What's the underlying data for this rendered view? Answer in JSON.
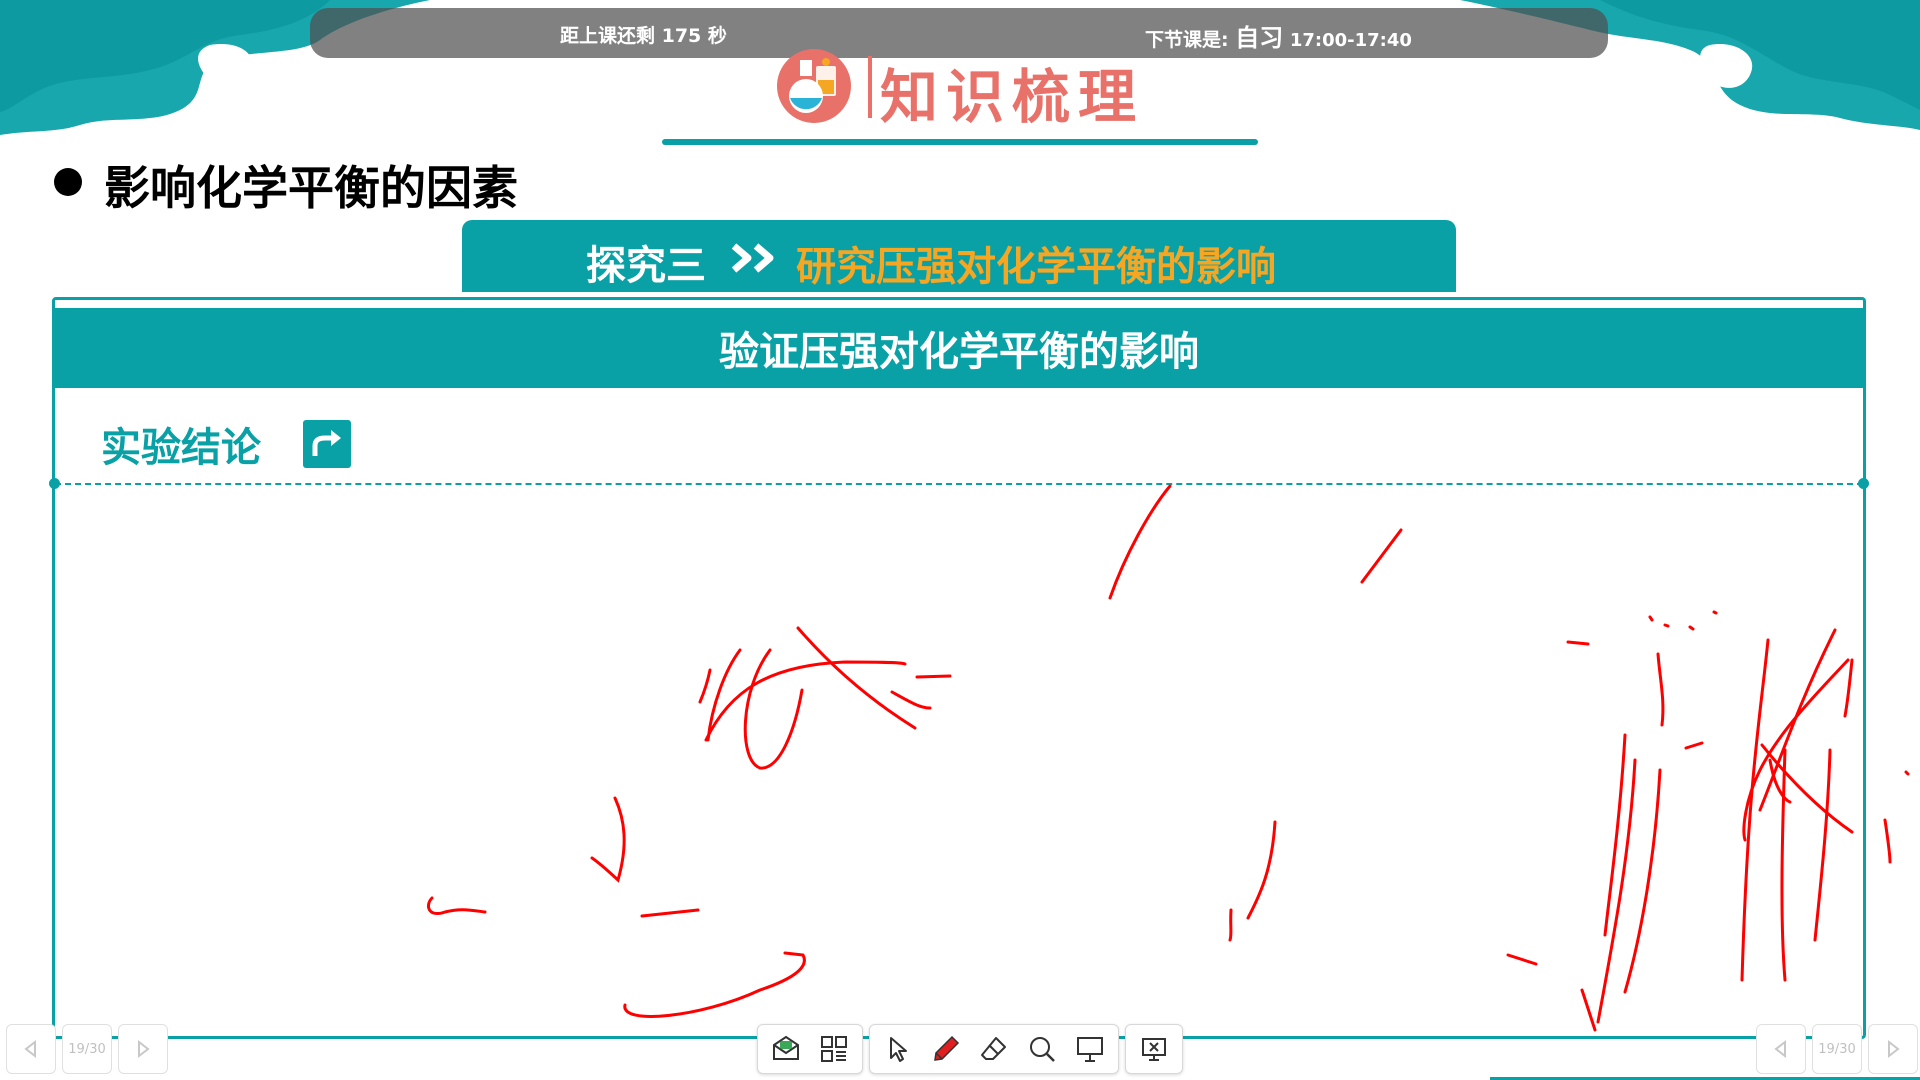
{
  "status_bar": {
    "countdown": "距上课还剩 175 秒",
    "next_label": "下节课是:",
    "next_subject": "自习",
    "next_time": "17:00-17:40"
  },
  "slide": {
    "section_title": "知识梳理",
    "bullet_heading": "影响化学平衡的因素",
    "inquiry_label": "探究三",
    "inquiry_topic": "研究压强对化学平衡的影响",
    "card_title": "验证压强对化学平衡的影响",
    "conclusion_label": "实验结论"
  },
  "navigation": {
    "page_left": "19/30",
    "page_right": "19/30"
  },
  "toolbar": {
    "icons": [
      "envelope-icon",
      "qr-code-icon",
      "cursor-icon",
      "pen-icon",
      "eraser-icon",
      "magnifier-icon",
      "screen-icon",
      "close-screen-icon"
    ]
  },
  "colors": {
    "teal": "#0aa1a6",
    "title_coral": "#e8716a",
    "topic_orange": "#f5a623",
    "ink_red": "#ff0000"
  }
}
